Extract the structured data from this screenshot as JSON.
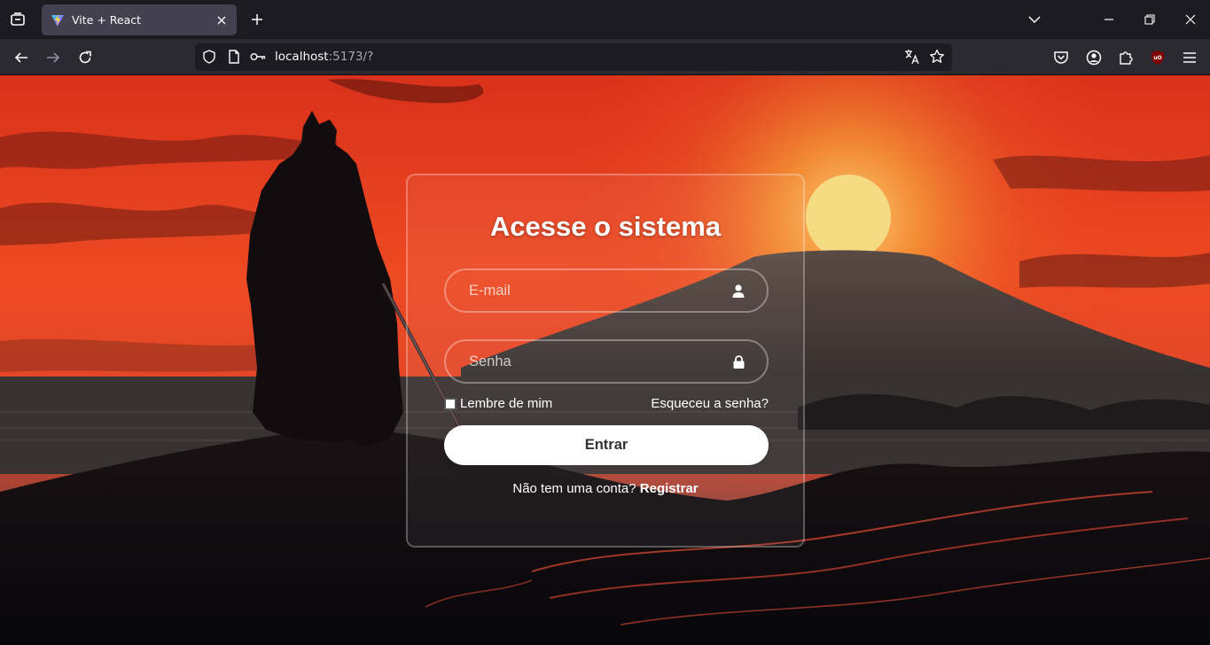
{
  "browser": {
    "tab": {
      "title": "Vite + React"
    },
    "url": {
      "host": "localhost",
      "rest": ":5173/?"
    }
  },
  "login": {
    "title": "Acesse o sistema",
    "email_placeholder": "E-mail",
    "password_placeholder": "Senha",
    "remember_label": "Lembre de mim",
    "forgot_label": "Esqueceu a senha?",
    "submit_label": "Entrar",
    "register_prompt": "Não tem uma conta?",
    "register_link": "Registrar"
  },
  "icons": {
    "tab_list": "tab-list-icon",
    "favicon": "vite-logo-icon",
    "close_tab": "close-icon",
    "new_tab": "plus-icon",
    "tab_overflow": "chevron-down-icon",
    "minimize": "minimize-icon",
    "maximize": "restore-icon",
    "close_window": "close-icon",
    "back": "arrow-left-icon",
    "forward": "arrow-right-icon",
    "reload": "reload-icon",
    "tracking_protection": "shield-icon",
    "page_info": "page-icon",
    "permissions": "key-icon",
    "translate": "translate-icon",
    "bookmark": "star-icon",
    "pocket": "pocket-icon",
    "account": "account-icon",
    "extensions": "puzzle-icon",
    "ublock": "ublock-icon",
    "menu": "hamburger-menu-icon",
    "user": "user-icon",
    "lock": "lock-icon"
  },
  "colors": {
    "sky_red": "#e23a1f",
    "sun": "#f7d774",
    "chrome_dark": "#1c1b22",
    "chrome_nav": "#2b2a33",
    "button_white": "#ffffff"
  }
}
